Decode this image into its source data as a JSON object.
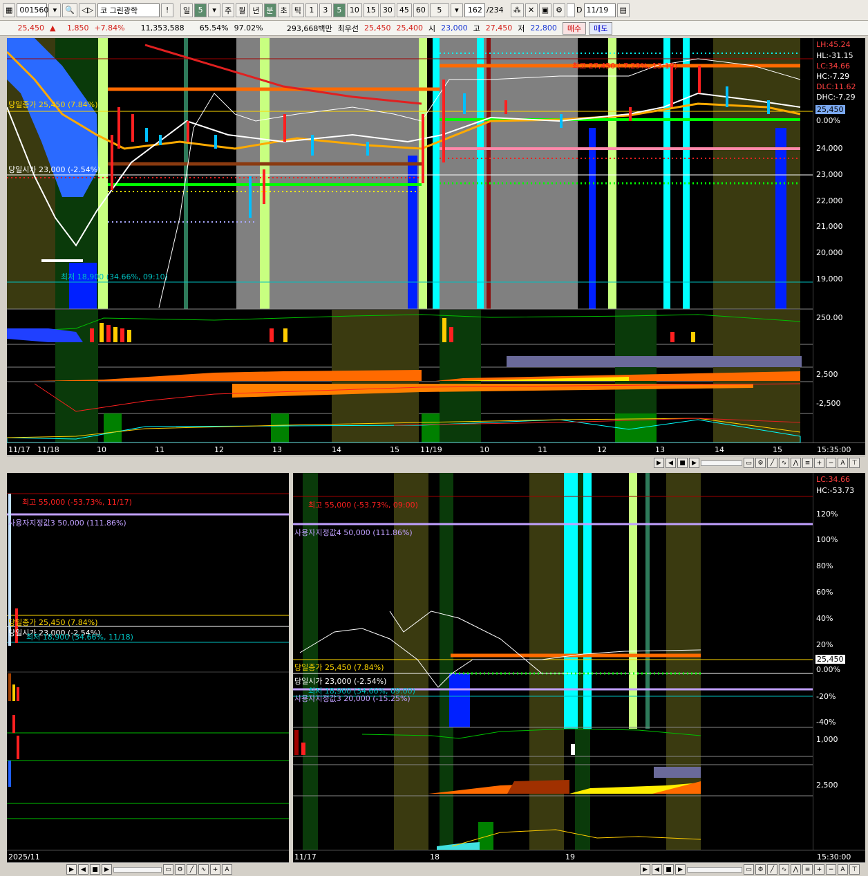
{
  "toolbar": {
    "code": "001560",
    "stock_prefix": "코",
    "stock_name": "그린광학",
    "alert": "!",
    "period_buttons": [
      "일",
      "5",
      "주",
      "월",
      "년",
      "분",
      "초",
      "틱",
      "1",
      "3",
      "5",
      "10",
      "15",
      "30",
      "45",
      "60",
      "5"
    ],
    "count_current": "162",
    "count_total": "/234",
    "date_flag": "D",
    "date": "11/19"
  },
  "quote": {
    "price": "25,450",
    "change_arrow": "▲",
    "change": "1,850",
    "change_pct": "+7.84%",
    "volume": "11,353,588",
    "rate1": "65.54%",
    "rate2": "97.02%",
    "amount": "293,668백만",
    "pref": "최우선",
    "ask": "25,450",
    "bid": "25,400",
    "open_label": "시",
    "open": "23,000",
    "high_label": "고",
    "high": "27,450",
    "low_label": "저",
    "low": "22,800",
    "buy_label": "매수",
    "sell_label": "매도"
  },
  "top_chart": {
    "right_labels": {
      "lh": "LH:45.24",
      "hl": "HL:-31.15",
      "lc": "LC:34.66",
      "hc": "HC:-7.29",
      "dlc": "DLC:11.62",
      "dhc": "DHC:-7.29",
      "price_tag": "25,450",
      "zero": "0.00%"
    },
    "price_ticks": [
      "24,000",
      "23,000",
      "22,000",
      "21,000",
      "20,000",
      "19,000"
    ],
    "vol_tick": "250.00",
    "ind_tick1": "2,500",
    "ind_tick2": "-2,500",
    "annotations": {
      "close_label": "당일종가 25,450 (7.84%)",
      "open_label": "당일시가 23,000 (-2.54%)",
      "high_label": "최고 27,450 (-7.29%, 13:19)",
      "low_label": "최저 18,900 (34.66%, 09:10)"
    },
    "dates": [
      "11/17",
      "11/18",
      "10",
      "11",
      "12",
      "13",
      "14",
      "15",
      "11/19",
      "10",
      "11",
      "12",
      "13",
      "14",
      "15"
    ],
    "time": "15:35:00"
  },
  "bottom_left_chart": {
    "annotations": {
      "high": "최고 55,000 (-53.73%, 11/17)",
      "user3": "사용자지정값3 50,000 (111.86%)",
      "close": "당일종가 25,450 (7.84%)",
      "open": "당일시가 23,000 (-2.54%)",
      "low": "최저 18,900 (34.66%, 11/18)"
    },
    "date": "2025/11"
  },
  "bottom_right_chart": {
    "right_labels": {
      "lc": "LC:34.66",
      "hc": "HC:-53.73",
      "price_tag": "25,450",
      "zero": "0.00%"
    },
    "pct_ticks": [
      "120%",
      "100%",
      "80%",
      "60%",
      "40%",
      "20%",
      "-20%",
      "-40%"
    ],
    "vol_tick": "1,000",
    "ind_tick": "2,500",
    "annotations": {
      "high": "최고 55,000 (-53.73%, 09:00)",
      "user4": "사용자지정값4 50,000 (111.86%)",
      "close": "당일종가 25,450 (7.84%)",
      "open": "당일시가 23,000 (-2.54%)",
      "low": "최저 18,900 (34.66%, 09:00)",
      "user3": "사용자지정값3 20,000 (-15.25%)"
    },
    "dates": [
      "11/17",
      "18",
      "19"
    ],
    "time": "15:30:00"
  },
  "colors": {
    "up": "#ff2020",
    "down": "#00c0ff",
    "bg": "#000000",
    "highlight_cyan": "#00ffff",
    "highlight_lime": "#c8ff80"
  }
}
